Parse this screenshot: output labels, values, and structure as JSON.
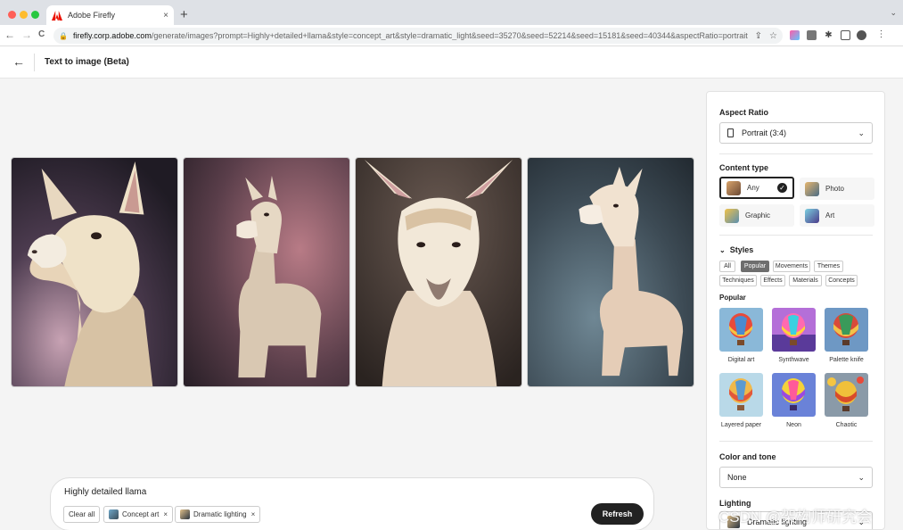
{
  "browser": {
    "tab_title": "Adobe Firefly",
    "tab_close": "×",
    "new_tab": "+",
    "url_host": "firefly.corp.adobe.com",
    "url_rest": "/generate/images?prompt=Highly+detailed+llama&style=concept_art&style=dramatic_light&seed=35270&seed=52214&seed=15181&seed=40344&aspectRatio=portrait...",
    "back_glyph": "←",
    "forward_glyph": "→",
    "reload_glyph": "C"
  },
  "header": {
    "back_glyph": "←",
    "title": "Text to image (Beta)"
  },
  "prompt": {
    "text": "Highly detailed llama",
    "clear_all": "Clear all",
    "chips": [
      {
        "label": "Concept art",
        "remove": "×"
      },
      {
        "label": "Dramatic lighting",
        "remove": "×"
      }
    ],
    "refresh": "Refresh"
  },
  "panel": {
    "aspect_ratio": {
      "heading": "Aspect Ratio",
      "value": "Portrait (3:4)"
    },
    "content_type": {
      "heading": "Content type",
      "options": [
        {
          "label": "Any",
          "selected": true
        },
        {
          "label": "Photo"
        },
        {
          "label": "Graphic"
        },
        {
          "label": "Art"
        }
      ]
    },
    "styles": {
      "heading": "Styles",
      "tabs": [
        "All",
        "Popular",
        "Movements",
        "Themes",
        "Techniques",
        "Effects",
        "Materials",
        "Concepts"
      ],
      "active_tab": "Popular",
      "section": "Popular",
      "tiles": [
        "Digital art",
        "Synthwave",
        "Palette knife",
        "Layered paper",
        "Neon",
        "Chaotic"
      ]
    },
    "color_tone": {
      "heading": "Color and tone",
      "value": "None"
    },
    "lighting": {
      "heading": "Lighting",
      "value": "Dramatic lighting"
    }
  },
  "watermark": "CSDN @架构师研究会",
  "colors": {
    "accent": "#222222",
    "firefly_red": "#eb1000",
    "active_tab": "#6e6e6e"
  }
}
